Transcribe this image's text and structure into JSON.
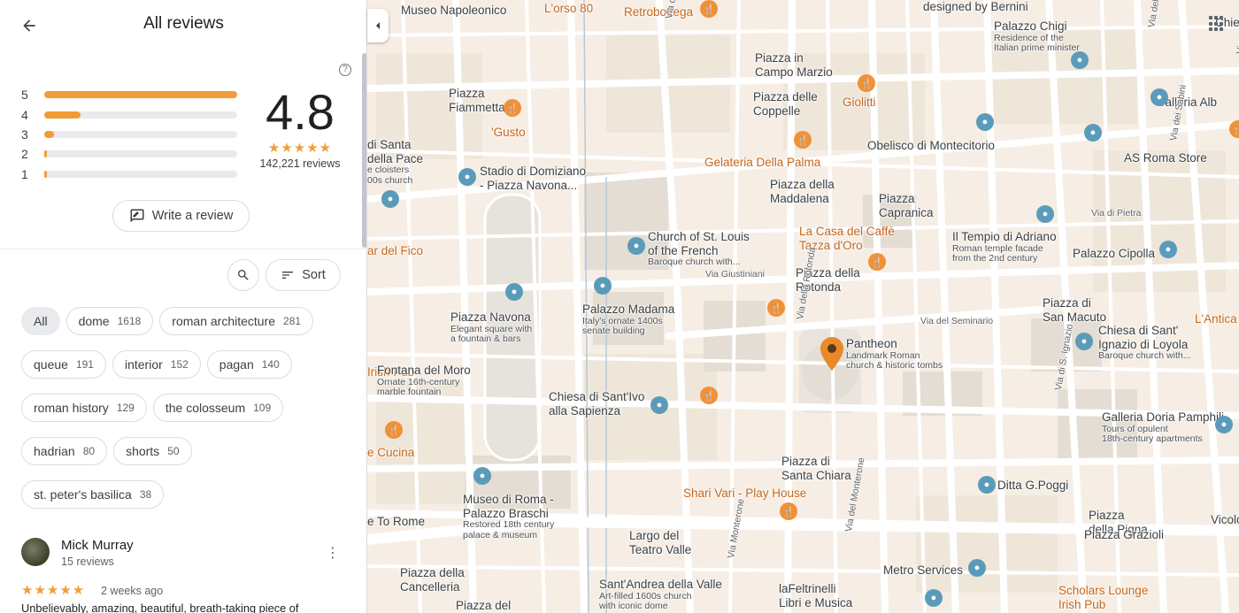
{
  "header": {
    "title": "All reviews",
    "back_icon": "arrow-back-icon"
  },
  "rating": {
    "value": "4.8",
    "stars": "★★★★★",
    "count": "142,221 reviews",
    "help_icon": "?",
    "distribution": [
      {
        "label": "5",
        "fraction": 1.0
      },
      {
        "label": "4",
        "fraction": 0.19
      },
      {
        "label": "3",
        "fraction": 0.05
      },
      {
        "label": "2",
        "fraction": 0.01
      },
      {
        "label": "1",
        "fraction": 0.01
      }
    ]
  },
  "actions": {
    "write_review": "Write a review",
    "sort": "Sort"
  },
  "topics": [
    [
      {
        "label": "All",
        "count": ""
      },
      {
        "label": "dome",
        "count": "1618"
      },
      {
        "label": "roman architecture",
        "count": "281"
      }
    ],
    [
      {
        "label": "queue",
        "count": "191"
      },
      {
        "label": "interior",
        "count": "152"
      },
      {
        "label": "pagan",
        "count": "140"
      }
    ],
    [
      {
        "label": "roman history",
        "count": "129"
      },
      {
        "label": "the colosseum",
        "count": "109"
      }
    ],
    [
      {
        "label": "hadrian",
        "count": "80"
      },
      {
        "label": "shorts",
        "count": "50"
      }
    ],
    [
      {
        "label": "st. peter's basilica",
        "count": "38"
      }
    ]
  ],
  "review": {
    "author": "Mick Murray",
    "author_reviews": "15 reviews",
    "stars": "★★★★★",
    "when": "2 weeks ago",
    "text": "Unbelievably, amazing, beautiful, breath-taking piece of"
  },
  "map": {
    "labels": [
      {
        "name": "Museo Napoleonico",
        "desc": ""
      },
      {
        "name": "L'orso 80",
        "desc": ""
      },
      {
        "name": "Retrobottega",
        "desc": ""
      },
      {
        "name": "designed by Bernini",
        "desc": ""
      },
      {
        "name": "Chie",
        "desc": ""
      },
      {
        "name": "Palazzo Chigi",
        "desc": "Residence of the|Italian prime minister"
      },
      {
        "name": "Piazza in|Campo Marzio",
        "desc": ""
      },
      {
        "name": "Piazza|Fiammetta",
        "desc": ""
      },
      {
        "name": "Piazza delle|Coppelle",
        "desc": ""
      },
      {
        "name": "Giolitti",
        "desc": ""
      },
      {
        "name": "Galleria Alb",
        "desc": ""
      },
      {
        "name": "'Gusto",
        "desc": ""
      },
      {
        "name": "Obelisco di Montecitorio",
        "desc": ""
      },
      {
        "name": "Via dei Sabini",
        "desc": ""
      },
      {
        "name": "di Santa|della Pace",
        "desc": "e cloisters|00s church"
      },
      {
        "name": "Stadio di Domiziano|- Piazza Navona...",
        "desc": ""
      },
      {
        "name": "Gelateria Della Palma",
        "desc": ""
      },
      {
        "name": "AS Roma Store",
        "desc": ""
      },
      {
        "name": "Piazza della|Maddalena",
        "desc": ""
      },
      {
        "name": "Piazza|Capranica",
        "desc": ""
      },
      {
        "name": "Via di Pietra",
        "desc": ""
      },
      {
        "name": "Church of St. Louis|of the French",
        "desc": "Baroque church with..."
      },
      {
        "name": "La Casa del Caffè|Tazza d'Oro",
        "desc": ""
      },
      {
        "name": "Il Tempio di Adriano",
        "desc": "Roman temple facade|from the 2nd century"
      },
      {
        "name": "ar del Fico",
        "desc": ""
      },
      {
        "name": "Palazzo Cipolla",
        "desc": ""
      },
      {
        "name": "Via Giustiniani",
        "desc": ""
      },
      {
        "name": "Piazza della|Rotonda",
        "desc": ""
      },
      {
        "name": "Palazzo Madama",
        "desc": "Italy's ornate 1400s|senate building"
      },
      {
        "name": "Piazza Navona",
        "desc": "Elegant square with|a fountain & bars"
      },
      {
        "name": "Via del Seminario",
        "desc": ""
      },
      {
        "name": "Piazza di|San Macuto",
        "desc": ""
      },
      {
        "name": "L'Antica",
        "desc": ""
      },
      {
        "name": "Pantheon",
        "desc": "Landmark Roman|church & historic tombs"
      },
      {
        "name": "Chiesa di Sant'|Ignazio di Loyola",
        "desc": "Baroque church with..."
      },
      {
        "name": "Irish Pub",
        "desc": ""
      },
      {
        "name": "Fontana del Moro",
        "desc": "Ornate 16th-century|marble fountain"
      },
      {
        "name": "Chiesa di Sant'Ivo|alla Sapienza",
        "desc": ""
      },
      {
        "name": "Galleria Doria Pamphilj",
        "desc": "Tours of opulent|18th-century apartments"
      },
      {
        "name": "e Cucina",
        "desc": ""
      },
      {
        "name": "Piazza di|Santa Chiara",
        "desc": ""
      },
      {
        "name": "Ditta G.Poggi",
        "desc": ""
      },
      {
        "name": "Shari Vari - Play House",
        "desc": ""
      },
      {
        "name": "Museo di Roma -|Palazzo Braschi",
        "desc": "Restored 18th century|palace & museum"
      },
      {
        "name": "Piazza|della Pigna",
        "desc": ""
      },
      {
        "name": "Piazza Grazioli",
        "desc": ""
      },
      {
        "name": "Largo del|Teatro Valle",
        "desc": ""
      },
      {
        "name": "e To Rome",
        "desc": ""
      },
      {
        "name": "Metro Services",
        "desc": ""
      },
      {
        "name": "Piazza della|Cancelleria",
        "desc": ""
      },
      {
        "name": "Sant'Andrea della Valle",
        "desc": "Art-filled 1600s church|with iconic dome"
      },
      {
        "name": "laFeltrinelli|Libri e Musica",
        "desc": ""
      },
      {
        "name": "Scholars Lounge|Irish Pub",
        "desc": ""
      },
      {
        "name": "Piazza del",
        "desc": ""
      },
      {
        "name": "Via della Scrofa",
        "desc": ""
      },
      {
        "name": "Via del Corso",
        "desc": ""
      },
      {
        "name": "Via della Rotonda",
        "desc": ""
      },
      {
        "name": "Via di S. Ignazio",
        "desc": ""
      },
      {
        "name": "Via Monterone",
        "desc": ""
      },
      {
        "name": "Via del Monterone",
        "desc": ""
      },
      {
        "name": "Via Lata",
        "desc": ""
      },
      {
        "name": "Vicolo del",
        "desc": ""
      }
    ]
  },
  "colors": {
    "accent": "#f29c38",
    "food": "#f19137",
    "pin": "#e8892a"
  }
}
